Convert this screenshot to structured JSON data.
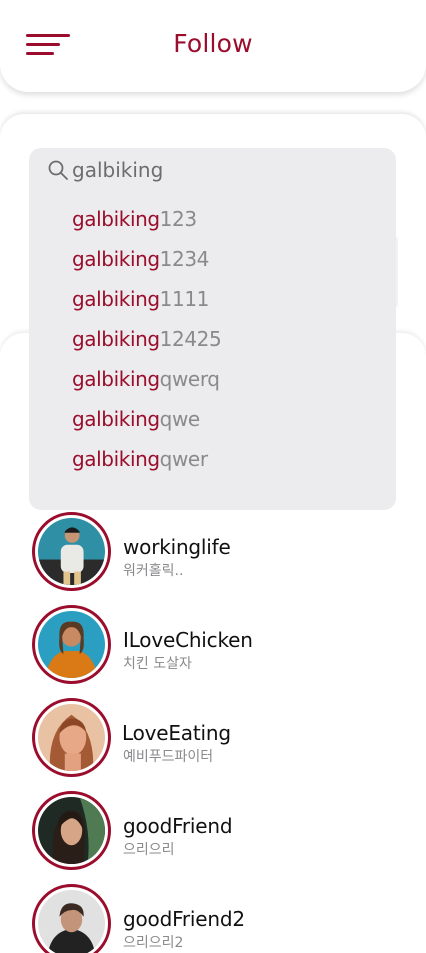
{
  "header": {
    "title": "Follow",
    "menu_icon": "hamburger-menu-icon",
    "accent_color": "#9b0d2d"
  },
  "search": {
    "value": "galbiking",
    "icon": "search-icon",
    "suggestions": [
      {
        "match": "galbiking",
        "rest": "123"
      },
      {
        "match": "galbiking",
        "rest": "1234"
      },
      {
        "match": "galbiking",
        "rest": "1111"
      },
      {
        "match": "galbiking",
        "rest": "12425"
      },
      {
        "match": "galbiking",
        "rest": "qwerq"
      },
      {
        "match": "galbiking",
        "rest": "qwe"
      },
      {
        "match": "galbiking",
        "rest": "qwer"
      }
    ]
  },
  "users": [
    {
      "name": "workinglife",
      "subtitle": "워커홀릭.."
    },
    {
      "name": "ILoveChicken",
      "subtitle": "치킨 도살자"
    },
    {
      "name": "LoveEating",
      "subtitle": "예비푸드파이터"
    },
    {
      "name": "goodFriend",
      "subtitle": "으리으리"
    },
    {
      "name": "goodFriend2",
      "subtitle": "으리으리2"
    }
  ]
}
